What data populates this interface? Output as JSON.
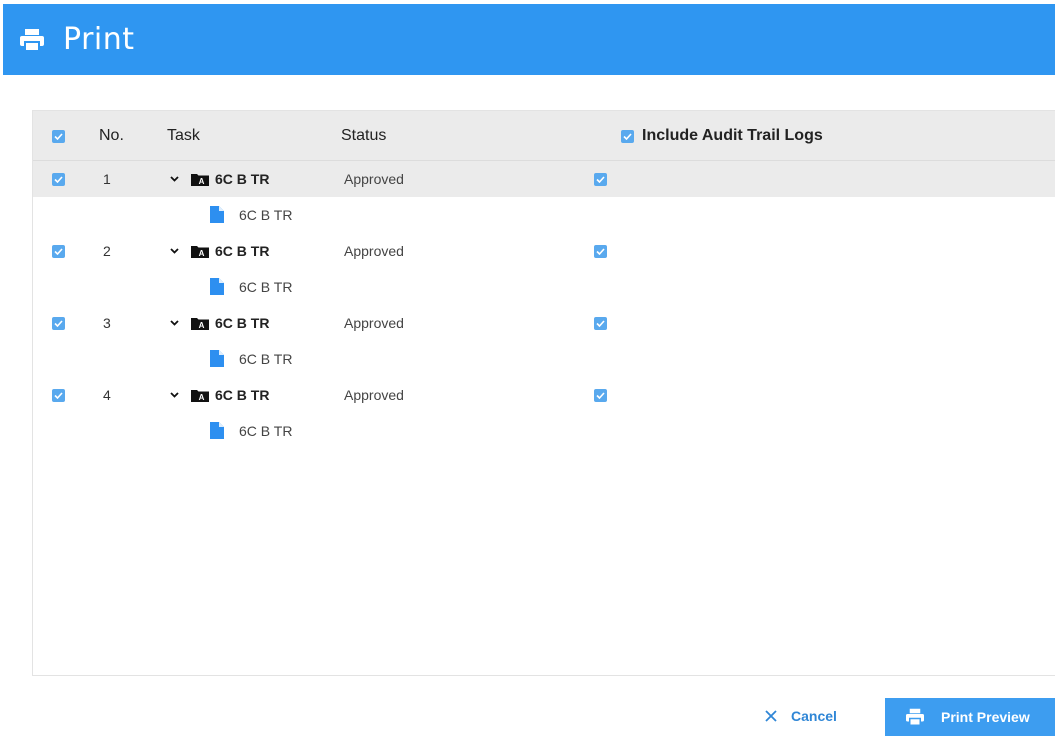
{
  "dialog": {
    "title": "Print",
    "icon": "printer-icon",
    "accent_color": "#2f96f1"
  },
  "table": {
    "columns": {
      "select_all_checked": true,
      "no": "No.",
      "task": "Task",
      "status": "Status",
      "audit_checked": true,
      "audit": "Include Audit Trail Logs"
    },
    "rows": [
      {
        "no": "1",
        "task": "6C B TR",
        "status": "Approved",
        "child": "6C B TR",
        "checked": true,
        "audit_checked": true,
        "selected": true
      },
      {
        "no": "2",
        "task": "6C B TR",
        "status": "Approved",
        "child": "6C B TR",
        "checked": true,
        "audit_checked": true,
        "selected": false
      },
      {
        "no": "3",
        "task": "6C B TR",
        "status": "Approved",
        "child": "6C B TR",
        "checked": true,
        "audit_checked": true,
        "selected": false
      },
      {
        "no": "4",
        "task": "6C B TR",
        "status": "Approved",
        "child": "6C B TR",
        "checked": true,
        "audit_checked": true,
        "selected": false
      }
    ]
  },
  "footer": {
    "cancel_label": "Cancel",
    "preview_label": "Print Preview"
  }
}
